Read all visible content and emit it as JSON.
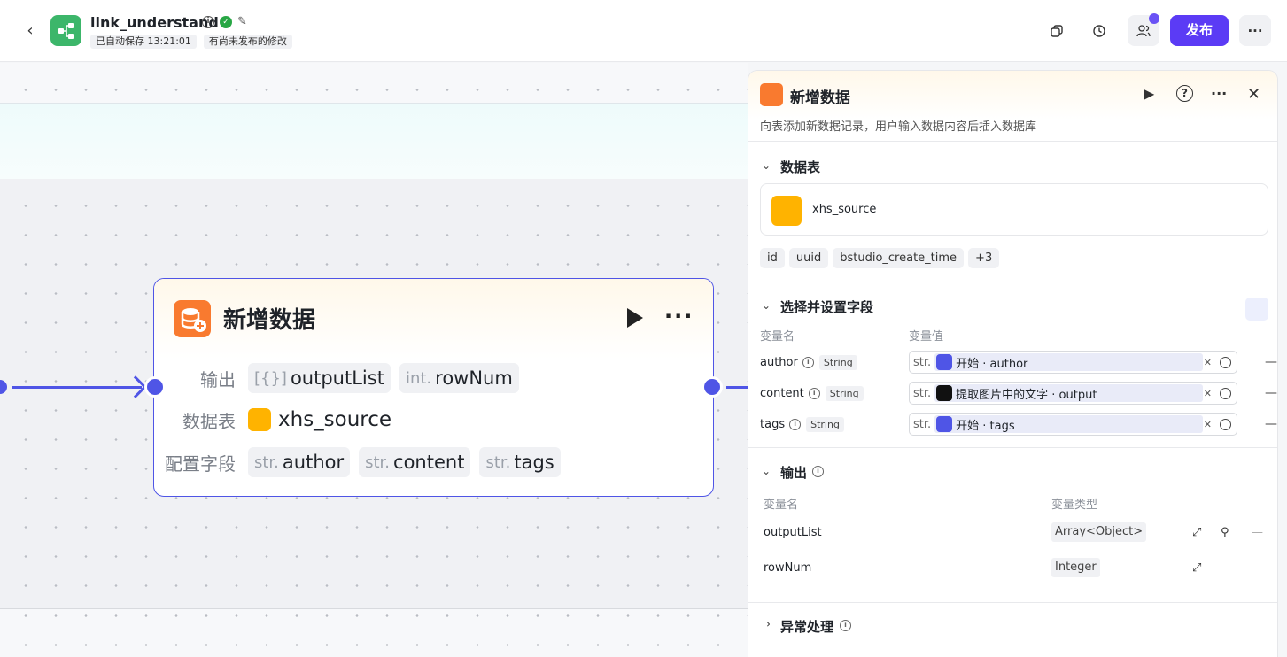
{
  "header": {
    "title": "link_understand",
    "autosave": "已自动保存 13:21:01",
    "unpublished": "有尚未发布的修改",
    "publish_label": "发布",
    "more_label": "···"
  },
  "node": {
    "title": "新增数据",
    "more_label": "···",
    "rows": [
      {
        "label": "输出",
        "tags": [
          {
            "prefix": "[{}]",
            "text": "outputList"
          },
          {
            "prefix": "int.",
            "text": "rowNum"
          }
        ]
      },
      {
        "label": "数据表",
        "value": "xhs_source"
      },
      {
        "label": "配置字段",
        "tags": [
          {
            "prefix": "str.",
            "text": "author"
          },
          {
            "prefix": "str.",
            "text": "content"
          },
          {
            "prefix": "str.",
            "text": "tags"
          }
        ]
      }
    ]
  },
  "panel": {
    "title": "新增数据",
    "description": "向表添加新数据记录，用户输入数据内容后插入数据库",
    "table_section": {
      "title": "数据表",
      "table_name": "xhs_source",
      "fields": [
        "id",
        "uuid",
        "bstudio_create_time",
        "+3"
      ]
    },
    "fields_section": {
      "title": "选择并设置字段",
      "col_name": "变量名",
      "col_value": "变量值",
      "rows": [
        {
          "name": "author",
          "type": "String",
          "prefix": "str.",
          "value": "开始 · author"
        },
        {
          "name": "content",
          "type": "String",
          "prefix": "str.",
          "value": "提取图片中的文字 · output"
        },
        {
          "name": "tags",
          "type": "String",
          "prefix": "str.",
          "value": "开始 · tags"
        }
      ]
    },
    "output_section": {
      "title": "输出",
      "col_name": "变量名",
      "col_type": "变量类型",
      "rows": [
        {
          "name": "outputList",
          "type": "Array<Object>"
        },
        {
          "name": "rowNum",
          "type": "Integer"
        }
      ]
    },
    "error_section": {
      "title": "异常处理"
    }
  },
  "colors": {
    "accent": "#4f55e6",
    "publish": "#5b3bf5",
    "node_icon": "#f97a2f",
    "db_icon": "#ffb300"
  }
}
